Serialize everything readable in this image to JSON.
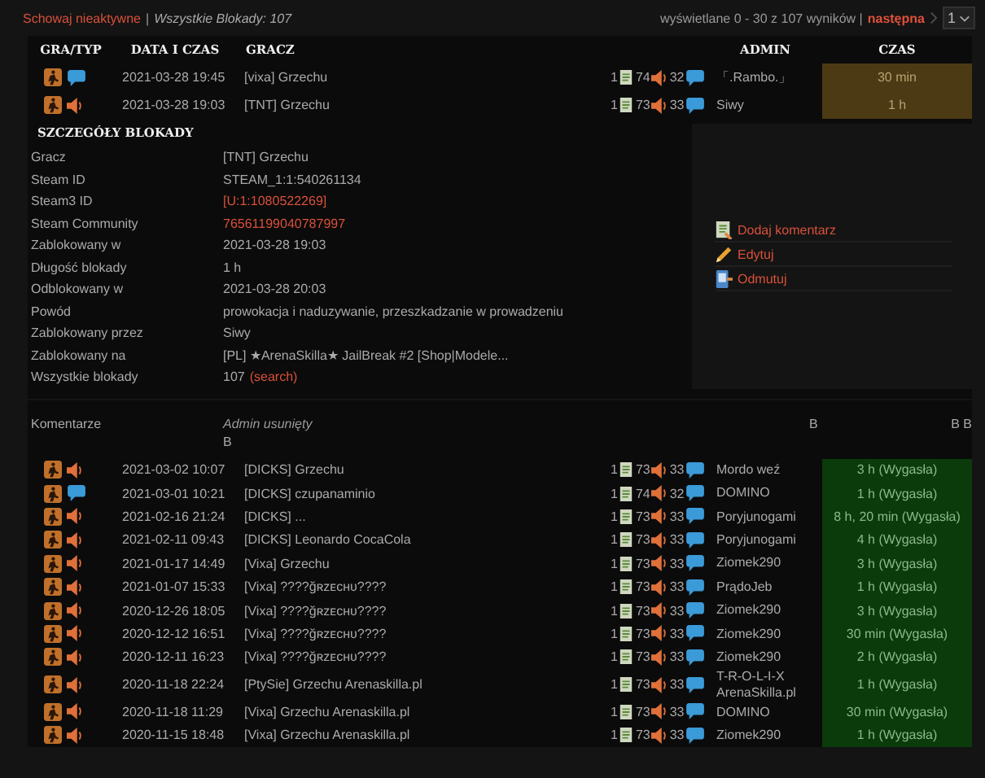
{
  "topbar": {
    "hide_link": "Schowaj nieaktywne",
    "separator": "|",
    "total": "Wszystkie Blokady: 107",
    "paging": "wyświetlane 0 - 30 z 107 wyników |",
    "next": "następna",
    "page_select": "1"
  },
  "columns": [
    "GRA/TYP",
    "DATA I CZAS",
    "GRACZ",
    "ADMIN",
    "CZAS"
  ],
  "bans": [
    {
      "kind": "chat",
      "date": "2021-03-28 19:45",
      "player": "[vixa] Grzechu",
      "count_1": "1",
      "count_2": "74",
      "count_3": "32",
      "admin": "「.Rambo.」",
      "time": "30 min",
      "expired": false
    },
    {
      "kind": "voice",
      "date": "2021-03-28 19:03",
      "player": "[TNT] Grzechu",
      "count_1": "1",
      "count_2": "73",
      "count_3": "33",
      "admin": "Siwy",
      "time": "1 h",
      "expired": false
    }
  ],
  "details": {
    "title": "SZCZEGÓŁY BLOKADY",
    "rows": [
      {
        "label": "Gracz",
        "value": "[TNT] Grzechu",
        "kind": "text"
      },
      {
        "label": "Steam ID",
        "value": "STEAM_1:1:540261134",
        "kind": "text"
      },
      {
        "label": "Steam3 ID",
        "value": "[U:1:1080522269]",
        "kind": "link"
      },
      {
        "label": "Steam Community",
        "value": "76561199040787997",
        "kind": "link"
      },
      {
        "label": "Zablokowany w",
        "value": "2021-03-28 19:03",
        "kind": "text"
      },
      {
        "label": "Długość blokady",
        "value": "1 h",
        "kind": "text"
      },
      {
        "label": "Odblokowany w",
        "value": "2021-03-28 20:03",
        "kind": "text"
      },
      {
        "label": "Powód",
        "value": "prowokacja i naduzywanie, przeszkadzanie w prowadzeniu",
        "kind": "text"
      },
      {
        "label": "Zablokowany przez",
        "value": "Siwy",
        "kind": "text"
      },
      {
        "label": "Zablokowany na",
        "value": "[PL] ★ArenaSkilla★ JailBreak #2 [Shop|Modele...",
        "kind": "text"
      },
      {
        "label": "Wszystkie blokady",
        "value": "107",
        "link": "(search)",
        "kind": "text"
      }
    ],
    "actions": [
      {
        "label": "Dodaj komentarz",
        "kind": "comment"
      },
      {
        "label": "Edytuj",
        "kind": "edit"
      },
      {
        "label": "Odmutuj",
        "kind": "unmute"
      }
    ]
  },
  "comments": {
    "label": "Komentarze",
    "author": "Admin usunięty",
    "text": "B",
    "mark_1": "B",
    "mark_2": "B B"
  },
  "history": [
    {
      "kind": "voice",
      "date": "2021-03-02 10:07",
      "player": "[DICKS] Grzechu",
      "count_1": "1",
      "count_2": "73",
      "count_3": "33",
      "admin": "Mordo weź",
      "time": "3 h (Wygasła)",
      "expired": true
    },
    {
      "kind": "chat",
      "date": "2021-03-01 10:21",
      "player": "[DICKS] czupanaminio",
      "count_1": "1",
      "count_2": "74",
      "count_3": "32",
      "admin": "DOMINO",
      "time": "1 h (Wygasła)",
      "expired": true
    },
    {
      "kind": "voice",
      "date": "2021-02-16 21:24",
      "player": "[DICKS] ...",
      "count_1": "1",
      "count_2": "73",
      "count_3": "33",
      "admin": "Poryjunogami",
      "time": "8 h, 20 min (Wygasła)",
      "expired": true
    },
    {
      "kind": "voice",
      "date": "2021-02-11 09:43",
      "player": "[DICKS] Leonardo CocaCola",
      "count_1": "1",
      "count_2": "73",
      "count_3": "33",
      "admin": "Poryjunogami",
      "time": "4 h (Wygasła)",
      "expired": true
    },
    {
      "kind": "voice",
      "date": "2021-01-17 14:49",
      "player": "[Vixa] Grzechu",
      "count_1": "1",
      "count_2": "73",
      "count_3": "33",
      "admin": "Ziomek290",
      "time": "3 h (Wygasła)",
      "expired": true
    },
    {
      "kind": "voice",
      "date": "2021-01-07 15:33",
      "player": "[Vixa] ????ğʀᴢᴇᴄʜᴜ????",
      "count_1": "1",
      "count_2": "73",
      "count_3": "33",
      "admin": "PrądoJeb",
      "time": "1 h (Wygasła)",
      "expired": true
    },
    {
      "kind": "voice",
      "date": "2020-12-26 18:05",
      "player": "[Vixa] ????ğʀᴢᴇᴄʜᴜ????",
      "count_1": "1",
      "count_2": "73",
      "count_3": "33",
      "admin": "Ziomek290",
      "time": "3 h (Wygasła)",
      "expired": true
    },
    {
      "kind": "voice",
      "date": "2020-12-12 16:51",
      "player": "[Vixa] ????ğʀᴢᴇᴄʜᴜ????",
      "count_1": "1",
      "count_2": "73",
      "count_3": "33",
      "admin": "Ziomek290",
      "time": "30 min (Wygasła)",
      "expired": true
    },
    {
      "kind": "voice",
      "date": "2020-12-11 16:23",
      "player": "[Vixa] ????ğʀᴢᴇᴄʜᴜ????",
      "count_1": "1",
      "count_2": "73",
      "count_3": "33",
      "admin": "Ziomek290",
      "time": "2 h (Wygasła)",
      "expired": true
    },
    {
      "kind": "voice",
      "date": "2020-11-18 22:24",
      "player": "[PtySie] Grzechu Arenaskilla.pl",
      "count_1": "1",
      "count_2": "73",
      "count_3": "33",
      "admin": "T-R-O-L-I-X ArenaSkilla.pl",
      "time": "1 h (Wygasła)",
      "expired": true
    },
    {
      "kind": "voice",
      "date": "2020-11-18 11:29",
      "player": "[Vixa] Grzechu Arenaskilla.pl",
      "count_1": "1",
      "count_2": "73",
      "count_3": "33",
      "admin": "DOMINO",
      "time": "30 min (Wygasła)",
      "expired": true
    },
    {
      "kind": "voice",
      "date": "2020-11-15 18:48",
      "player": "[Vixa] Grzechu Arenaskilla.pl",
      "count_1": "1",
      "count_2": "73",
      "count_3": "33",
      "admin": "Ziomek290",
      "time": "1 h (Wygasła)",
      "expired": true
    }
  ]
}
